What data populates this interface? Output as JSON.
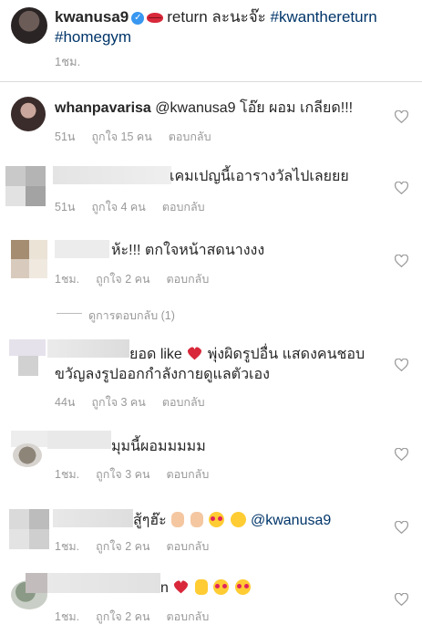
{
  "caption": {
    "username": "kwanusa9",
    "text_after_emoji": "return ละนะจ๊ะ",
    "hashtags": [
      "#kwanthereturn",
      "#homegym"
    ],
    "time": "1ชม."
  },
  "comments": [
    {
      "username": "whanpavarisa",
      "text": "@kwanusa9 โอ๊ย ผอม เกลียด!!!",
      "time": "51น",
      "likes": "ถูกใจ 15 คน",
      "reply": "ตอบกลับ"
    },
    {
      "username": "",
      "text": "เคมเปญนี้เอารางวัลไปเลยยย",
      "time": "51น",
      "likes": "ถูกใจ 4 คน",
      "reply": "ตอบกลับ"
    },
    {
      "username": "",
      "text": "ห้ะ!!! ตกใจหน้าสดนางงง",
      "time": "1ชม.",
      "likes": "ถูกใจ 2 คน",
      "reply": "ตอบกลับ",
      "view_replies": "ดูการตอบกลับ (1)"
    },
    {
      "username": "",
      "text_part1": "ยอด like",
      "text_part2": "พุ่งผิดรูปอื่น แสดงคนชอบ",
      "text_line2": "ขวัญลงรูปออกกำลังกายดูแลตัวเอง",
      "time": "44น",
      "likes": "ถูกใจ 3 คน",
      "reply": "ตอบกลับ"
    },
    {
      "username": "",
      "text": "มุมนี้ผอมมมมม",
      "time": "1ชม.",
      "likes": "ถูกใจ 3 คน",
      "reply": "ตอบกลับ"
    },
    {
      "username": "",
      "text": "สู้ๆฮ๊ะ",
      "mention": "@kwanusa9",
      "time": "1ชม.",
      "likes": "ถูกใจ 2 คน",
      "reply": "ตอบกลับ"
    },
    {
      "username": "",
      "text": "n",
      "time": "1ชม.",
      "likes": "ถูกใจ 2 คน",
      "reply": "ตอบกลับ"
    }
  ],
  "colors": {
    "heart_emoji": "#d8283a",
    "hashtag": "#003569",
    "meta": "#999999",
    "verified": "#3897f0"
  }
}
